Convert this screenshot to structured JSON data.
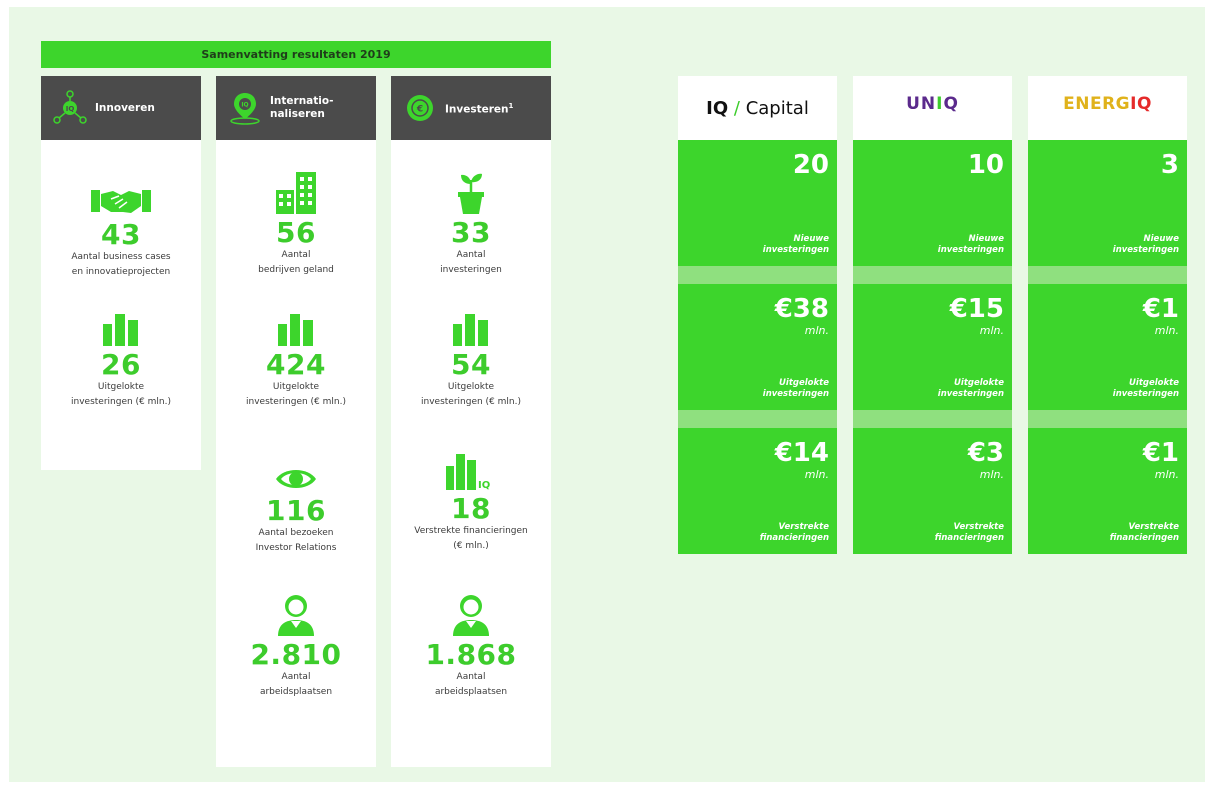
{
  "banner": {
    "title": "Samenvatting resultaten 2019"
  },
  "columns": [
    {
      "title": "Innoveren",
      "sup": "",
      "stats": [
        {
          "value": "43",
          "label": "Aantal business cases\nen innovatieprojecten",
          "icon": "handshake-icon"
        },
        {
          "value": "26",
          "label": "Uitgelokte\ninvesteringen (€ mln.)",
          "icon": "bar-chart-icon"
        }
      ]
    },
    {
      "title": "Internatio-\nnaliseren",
      "sup": "",
      "stats": [
        {
          "value": "56",
          "label": "Aantal\nbedrijven geland",
          "icon": "buildings-icon"
        },
        {
          "value": "424",
          "label": "Uitgelokte\ninvesteringen (€ mln.)",
          "icon": "bar-chart-icon"
        },
        {
          "value": "116",
          "label": "Aantal bezoeken\nInvestor Relations",
          "icon": "eye-icon"
        },
        {
          "value": "2.810",
          "label": "Aantal\narbeidsplaatsen",
          "icon": "person-icon"
        }
      ]
    },
    {
      "title": "Investeren",
      "sup": "1",
      "stats": [
        {
          "value": "33",
          "label": "Aantal\ninvesteringen",
          "icon": "plant-icon"
        },
        {
          "value": "54",
          "label": "Uitgelokte\ninvesteringen (€ mln.)",
          "icon": "bar-chart-icon"
        },
        {
          "value": "18",
          "label": "Verstrekte financieringen\n(€ mln.)",
          "icon": "bar-chart-iq-icon"
        },
        {
          "value": "1.868",
          "label": "Aantal\narbeidsplaatsen",
          "icon": "person-icon"
        }
      ]
    }
  ],
  "funds": [
    {
      "brand": "IQ / Capital",
      "brand_parts": [
        "IQ",
        "/",
        "Capital"
      ],
      "cells": [
        {
          "value": "20",
          "unit": "",
          "label": "Nieuwe\ninvesteringen"
        },
        {
          "value": "€38",
          "unit": "mln.",
          "label": "Uitgelokte\ninvesteringen"
        },
        {
          "value": "€14",
          "unit": "mln.",
          "label": "Verstrekte\nfinancieringen"
        }
      ]
    },
    {
      "brand": "UNIQ",
      "brand_parts": [
        "UN",
        "I",
        "Q"
      ],
      "cells": [
        {
          "value": "10",
          "unit": "",
          "label": "Nieuwe\ninvesteringen"
        },
        {
          "value": "€15",
          "unit": "mln.",
          "label": "Uitgelokte\ninvesteringen"
        },
        {
          "value": "€3",
          "unit": "mln.",
          "label": "Verstrekte\nfinancieringen"
        }
      ]
    },
    {
      "brand": "ENERGIQ",
      "brand_parts": [
        "ENERG",
        "I",
        "Q"
      ],
      "cells": [
        {
          "value": "3",
          "unit": "",
          "label": "Nieuwe\ninvesteringen"
        },
        {
          "value": "€1",
          "unit": "mln.",
          "label": "Uitgelokte\ninvesteringen"
        },
        {
          "value": "€1",
          "unit": "mln.",
          "label": "Verstrekte\nfinancieringen"
        }
      ]
    }
  ],
  "colors": {
    "accent": "#3dd52c",
    "accent_text": "#3dcc2c",
    "header_dark": "#4b4b4b",
    "background": "#e9f8e6",
    "uniq": "#5b2a8c",
    "energiq": "#e0b21b"
  }
}
